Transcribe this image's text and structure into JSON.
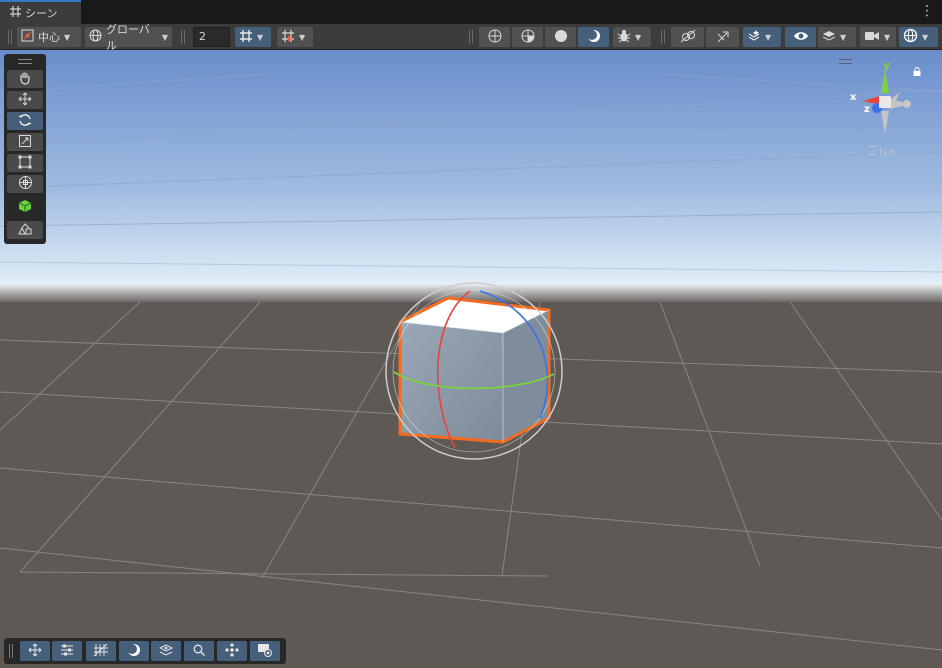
{
  "tab": {
    "label": "シーン",
    "icon": "grid-hash-icon"
  },
  "toolbar": {
    "pivot_label": "中心",
    "space_label": "グローバル",
    "snap_value": "2"
  },
  "gizmo": {
    "x_label": "x",
    "y_label": "y",
    "z_label": "z",
    "projection_label": "Iso"
  },
  "colors": {
    "accent": "#46607c",
    "selection_outline": "#f26c1f",
    "x_axis": "#e8443a",
    "y_axis": "#7bd23e",
    "z_axis": "#3d72e6",
    "sky_top": "#6b8fcb",
    "ground": "#5f5956"
  }
}
